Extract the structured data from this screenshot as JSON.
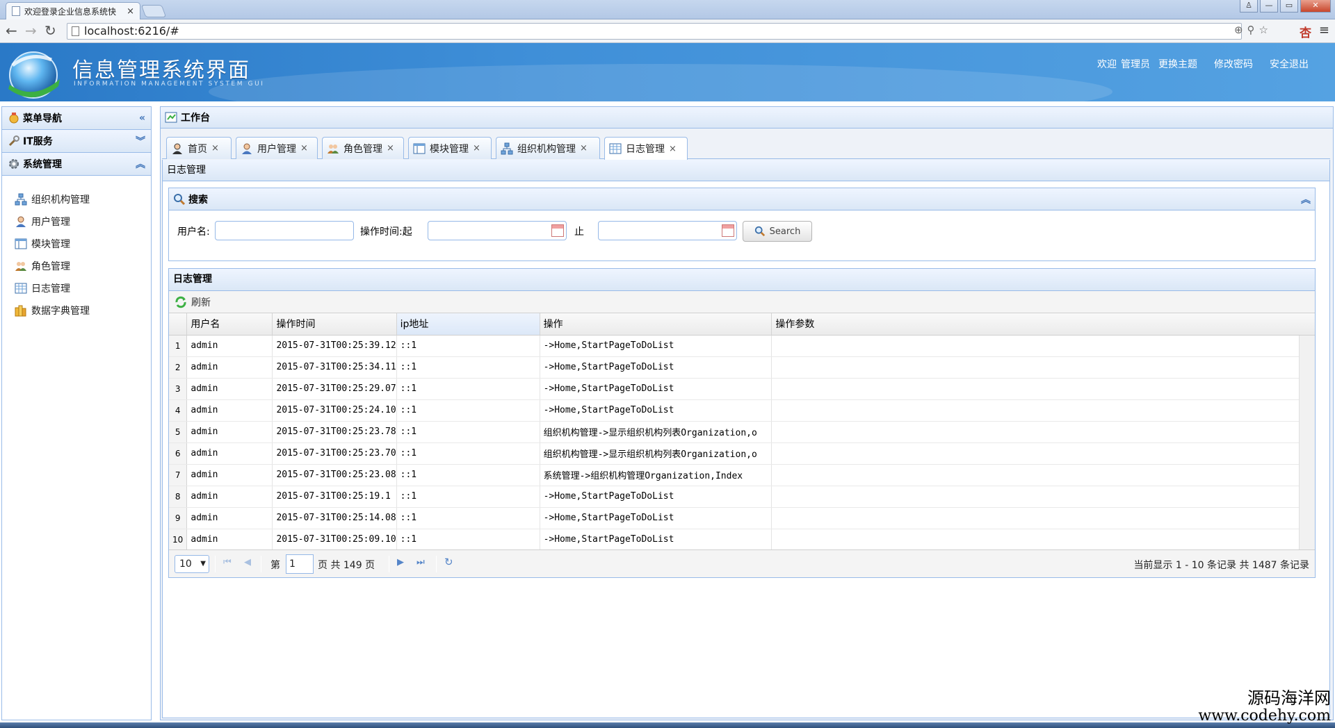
{
  "browser": {
    "tab_title": "欢迎登录企业信息系统快",
    "tab_close": "×",
    "url": "localhost:6216/#",
    "back": "←",
    "forward": "→",
    "reload": "↻",
    "url_icons": "⊕⚲☆",
    "ext_icon": "杏",
    "menu": "≡",
    "win_min": "—",
    "win_max": "▭",
    "win_close": "✕",
    "win_user": "♙"
  },
  "header": {
    "system_name": "信息管理系统界面",
    "system_name_en": "INFORMATION MANAGEMENT SYSTEM GUI",
    "welcome": "欢迎",
    "user": "管理员",
    "change_theme": "更换主题",
    "change_password": "修改密码",
    "logout": "安全退出"
  },
  "sidebar": {
    "title": "菜单导航",
    "collapse_icon": "«",
    "sections": [
      {
        "label": "IT服务",
        "arrow": "︾"
      },
      {
        "label": "系统管理",
        "arrow": "︽"
      }
    ],
    "items": [
      {
        "label": "组织机构管理"
      },
      {
        "label": "用户管理"
      },
      {
        "label": "模块管理"
      },
      {
        "label": "角色管理"
      },
      {
        "label": "日志管理"
      },
      {
        "label": "数据字典管理"
      }
    ]
  },
  "workbench": {
    "title": "工作台",
    "tabs": [
      {
        "label": "首页",
        "close": "×"
      },
      {
        "label": "用户管理",
        "close": "×"
      },
      {
        "label": "角色管理",
        "close": "×"
      },
      {
        "label": "模块管理",
        "close": "×"
      },
      {
        "label": "组织机构管理",
        "close": "×"
      },
      {
        "label": "日志管理",
        "close": "×"
      }
    ],
    "page_title": "日志管理"
  },
  "search": {
    "title": "搜索",
    "collapse_icon": "︽",
    "username_label": "用户名:",
    "username_value": "",
    "time_from_label": "操作时间:起",
    "time_from_value": "",
    "time_to_label": "止",
    "time_to_value": "",
    "button_label": "Search"
  },
  "grid": {
    "title": "日志管理",
    "refresh_label": "刷新",
    "columns": [
      "用户名",
      "操作时间",
      "ip地址",
      "操作",
      "操作参数"
    ],
    "rows": [
      {
        "n": "1",
        "user": "admin",
        "time": "2015-07-31T00:25:39.12",
        "ip": "::1",
        "op": "->Home,StartPageToDoList",
        "param": ""
      },
      {
        "n": "2",
        "user": "admin",
        "time": "2015-07-31T00:25:34.11",
        "ip": "::1",
        "op": "->Home,StartPageToDoList",
        "param": ""
      },
      {
        "n": "3",
        "user": "admin",
        "time": "2015-07-31T00:25:29.07",
        "ip": "::1",
        "op": "->Home,StartPageToDoList",
        "param": ""
      },
      {
        "n": "4",
        "user": "admin",
        "time": "2015-07-31T00:25:24.10",
        "ip": "::1",
        "op": "->Home,StartPageToDoList",
        "param": ""
      },
      {
        "n": "5",
        "user": "admin",
        "time": "2015-07-31T00:25:23.78",
        "ip": "::1",
        "op": "组织机构管理->显示组织机构列表Organization,o",
        "param": ""
      },
      {
        "n": "6",
        "user": "admin",
        "time": "2015-07-31T00:25:23.70",
        "ip": "::1",
        "op": "组织机构管理->显示组织机构列表Organization,o",
        "param": ""
      },
      {
        "n": "7",
        "user": "admin",
        "time": "2015-07-31T00:25:23.08",
        "ip": "::1",
        "op": "系统管理->组织机构管理Organization,Index",
        "param": ""
      },
      {
        "n": "8",
        "user": "admin",
        "time": "2015-07-31T00:25:19.1",
        "ip": "::1",
        "op": "->Home,StartPageToDoList",
        "param": ""
      },
      {
        "n": "9",
        "user": "admin",
        "time": "2015-07-31T00:25:14.08",
        "ip": "::1",
        "op": "->Home,StartPageToDoList",
        "param": ""
      },
      {
        "n": "10",
        "user": "admin",
        "time": "2015-07-31T00:25:09.10",
        "ip": "::1",
        "op": "->Home,StartPageToDoList",
        "param": ""
      }
    ]
  },
  "pager": {
    "page_size": "10",
    "dropdown": "▼",
    "first": "⏮",
    "prev": "◀",
    "next": "▶",
    "last": "⏭",
    "refresh": "↻",
    "page_prefix": "第",
    "page_value": "1",
    "page_suffix": "页 共 149 页",
    "info": "当前显示 1 - 10 条记录 共 1487 条记录"
  },
  "watermark": {
    "line1": "源码海洋网",
    "line2": "www.codehy.com"
  },
  "colors": {
    "accent": "#3f8fd8",
    "panel_border": "#99bbe8",
    "panel_header": "#dae7f6"
  }
}
